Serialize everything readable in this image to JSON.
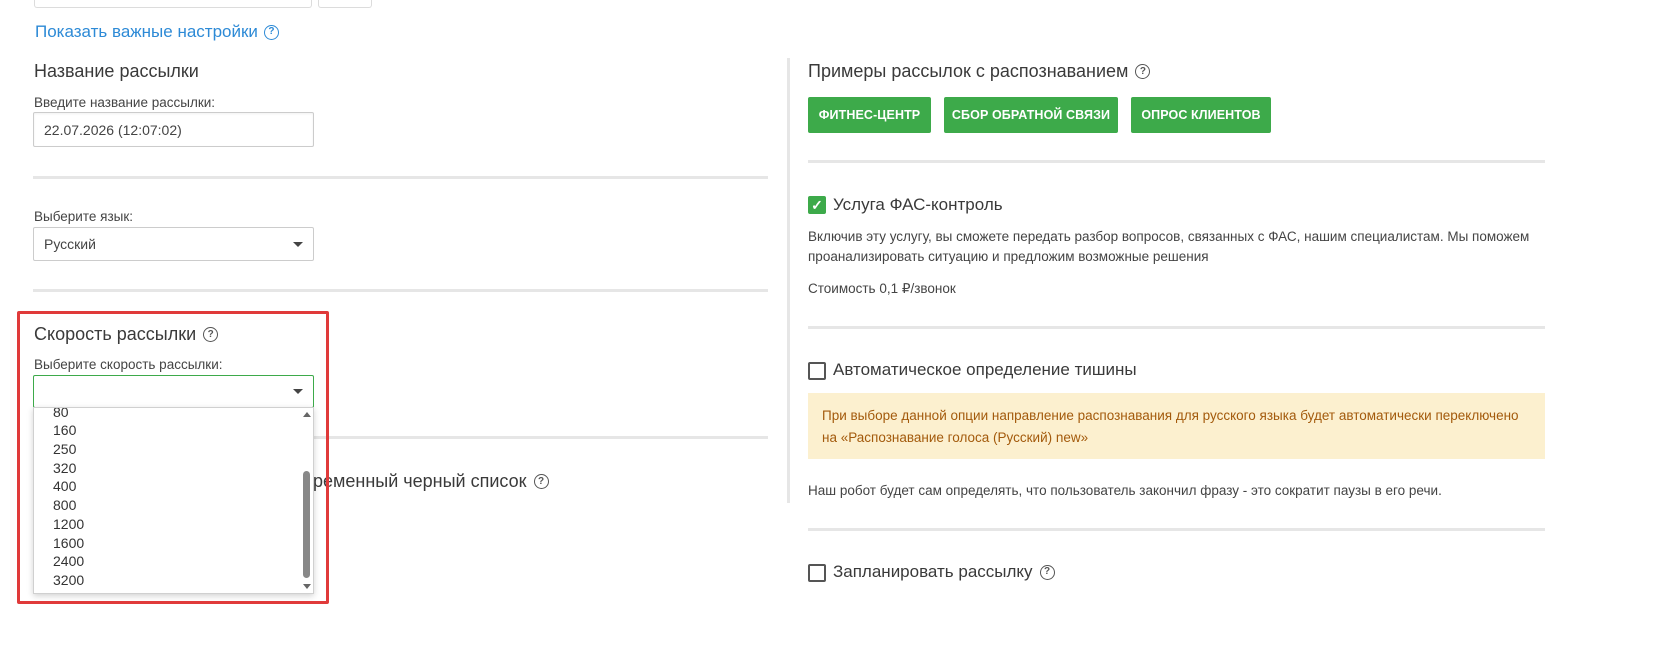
{
  "left": {
    "show_settings_link": "Показать важные настройки",
    "name_section": {
      "title": "Название рассылки",
      "label": "Введите название рассылки:",
      "value": "22.07.2026 (12:07:02)"
    },
    "language_section": {
      "label": "Выберите язык:",
      "value": "Русский"
    },
    "speed_section": {
      "title": "Скорость рассылки",
      "label": "Выберите скорость рассылки:",
      "value": "",
      "options": [
        "80",
        "160",
        "250",
        "320",
        "400",
        "800",
        "1200",
        "1600",
        "2400",
        "3200"
      ]
    },
    "blacklist_partial_label": "ременный черный список"
  },
  "right": {
    "examples_title": "Примеры рассылок с распознаванием",
    "example_buttons": [
      "ФИТНЕС-ЦЕНТР",
      "СБОР ОБРАТНОЙ СВЯЗИ",
      "ОПРОС КЛИЕНТОВ"
    ],
    "fas": {
      "checked": true,
      "title": "Услуга ФАС-контроль",
      "description": "Включив эту услугу, вы сможете передать разбор вопросов, связанных с ФАС, нашим специалистам. Мы поможем проанализировать ситуацию и предложим возможные решения",
      "price": "Стоимость 0,1 ₽/звонок"
    },
    "silence": {
      "checked": false,
      "title": "Автоматическое определение тишины",
      "notice": "При выборе данной опции направление распознавания для русского языка будет автоматически переключено на «Распознавание голоса (Русский) new»",
      "description": "Наш робот будет сам определять, что пользователь закончил фразу - это сократит паузы в его речи."
    },
    "schedule": {
      "checked": false,
      "title": "Запланировать рассылку"
    }
  },
  "colors": {
    "accent_link": "#2d8ad6",
    "button_green": "#3daa4a",
    "highlight_red": "#e03a3a",
    "notice_bg": "#fcf0cf",
    "notice_text": "#a35a0c"
  }
}
